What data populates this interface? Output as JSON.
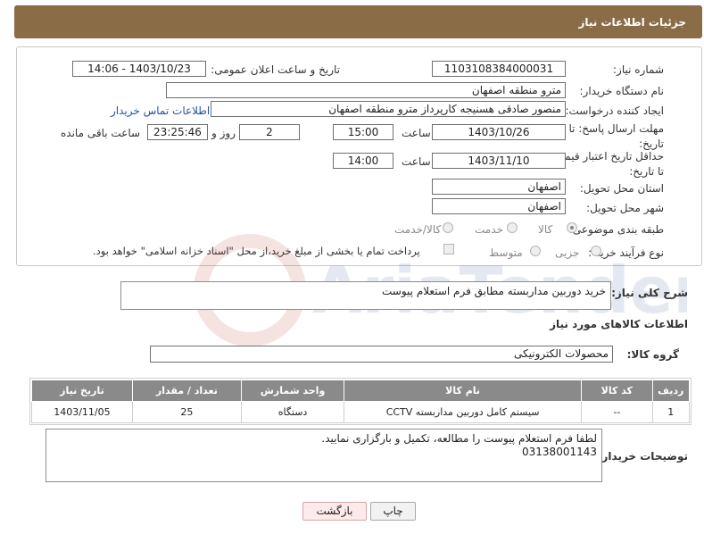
{
  "header": {
    "title": "جزئیات اطلاعات نیاز"
  },
  "form": {
    "need_number": {
      "label": "شماره نیاز:",
      "value": "1103108384000031"
    },
    "announce_datetime": {
      "label": "تاریخ و ساعت اعلان عمومی:",
      "value": "1403/10/23 - 14:06"
    },
    "buyer_org": {
      "label": "نام دستگاه خریدار:",
      "value": "مترو منطقه اصفهان"
    },
    "creator": {
      "label": "ایجاد کننده درخواست:",
      "value": "منصور صادقی هسنیجه کارپرداز مترو منطقه اصفهان",
      "contact_link": "اطلاعات تماس خریدار"
    },
    "response_deadline": {
      "label": "مهلت ارسال پاسخ: تا تاریخ:",
      "date": "1403/10/26",
      "time_label": "ساعت",
      "time": "15:00",
      "days": "2",
      "days_label": "روز و",
      "remaining": "23:25:46",
      "remaining_label": "ساعت باقی مانده"
    },
    "price_validity": {
      "label": "حداقل تاریخ اعتبار قیمت: تا تاریخ:",
      "date": "1403/11/10",
      "time_label": "ساعت",
      "time": "14:00"
    },
    "delivery_province": {
      "label": "استان محل تحویل:",
      "value": "اصفهان"
    },
    "delivery_city": {
      "label": "شهر محل تحویل:",
      "value": "اصفهان"
    },
    "category": {
      "label": "طبقه بندی موضوعی:",
      "options": [
        "کالا",
        "خدمت",
        "کالا/خدمت"
      ],
      "selected": "کالا"
    },
    "process_type": {
      "label": "نوع فرآیند خرید :",
      "options": [
        "جزیی",
        "متوسط"
      ],
      "payment_note": "پرداخت تمام یا بخشی از مبلغ خرید،از محل \"اسناد خزانه اسلامی\" خواهد بود."
    }
  },
  "description": {
    "label": "شرح کلی نیاز:",
    "value": "خرید دوربین مداربسته مطابق فرم استعلام پیوست"
  },
  "goods_section": {
    "title": "اطلاعات کالاهای مورد نیاز",
    "group_label": "گروه کالا:",
    "group_value": "محصولات الکترونیکی",
    "columns": [
      "ردیف",
      "کد کالا",
      "نام کالا",
      "واحد شمارش",
      "تعداد / مقدار",
      "تاریخ نیاز"
    ],
    "rows": [
      [
        "1",
        "--",
        "سیستم کامل دوربین مداربسته CCTV",
        "دستگاه",
        "25",
        "1403/11/05"
      ]
    ]
  },
  "buyer_notes": {
    "label": "توضیحات خریدار:",
    "value": "لطفا فرم استعلام پیوست را مطالعه، تکمیل و بارگزاری نمایید.\n03138001143"
  },
  "buttons": {
    "print": "چاپ",
    "back": "بازگشت"
  },
  "watermark": "AriaTender.net"
}
